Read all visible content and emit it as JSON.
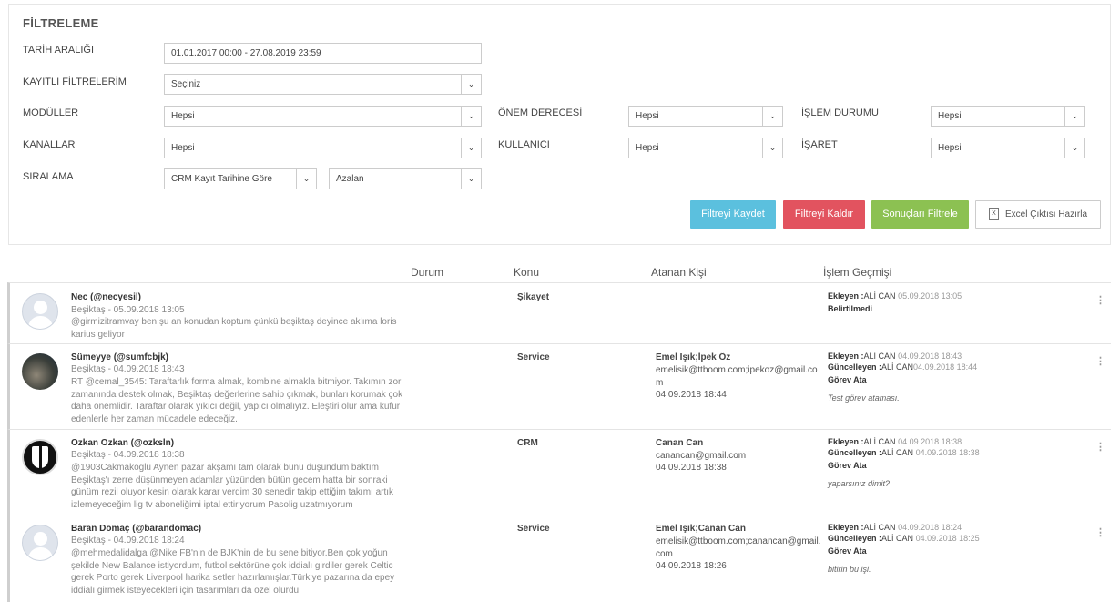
{
  "filters": {
    "title": "FİLTRELEME",
    "date_range": {
      "label": "TARİH ARALIĞI",
      "value": "01.01.2017 00:00 - 27.08.2019 23:59"
    },
    "saved_filters": {
      "label": "KAYITLI FİLTRELERİM",
      "value": "Seçiniz"
    },
    "modules": {
      "label": "MODÜLLER",
      "value": "Hepsi"
    },
    "channels": {
      "label": "KANALLAR",
      "value": "Hepsi"
    },
    "sorting": {
      "label": "SIRALAMA",
      "field": "CRM Kayıt Tarihine Göre",
      "order": "Azalan"
    },
    "priority": {
      "label": "ÖNEM DERECESİ",
      "value": "Hepsi"
    },
    "user": {
      "label": "KULLANICI",
      "value": "Hepsi"
    },
    "process_status": {
      "label": "İŞLEM DURUMU",
      "value": "Hepsi"
    },
    "mark": {
      "label": "İŞARET",
      "value": "Hepsi"
    },
    "buttons": {
      "save": "Filtreyi Kaydet",
      "remove": "Filtreyi Kaldır",
      "apply": "Sonuçları Filtrele",
      "excel": "Excel Çıktısı Hazırla"
    }
  },
  "table": {
    "headers": {
      "status": "Durum",
      "topic": "Konu",
      "assignee": "Atanan Kişi",
      "history": "İşlem Geçmişi"
    },
    "rows": [
      {
        "user": "Nec (@necyesil)",
        "meta": "Beşiktaş - 05.09.2018 13:05",
        "message": "@girmizitramvay ben şu an konudan koptum çünkü beşiktaş deyince aklıma loris karius geliyor",
        "topic": "Şikayet",
        "assignee_name": "",
        "assignee_email": "",
        "assignee_date": "",
        "history": [
          {
            "label": "Ekleyen :",
            "name": "ALİ CAN",
            "date": "05.09.2018 13:05"
          }
        ],
        "history_status": "Belirtilmedi",
        "history_note": ""
      },
      {
        "user": "Sümeyye (@sumfcbjk)",
        "meta": "Beşiktaş - 04.09.2018 18:43",
        "message": "RT @cemal_3545: Taraftarlık forma almak, kombine almakla bitmiyor. Takımın zor zamanında destek olmak, Beşiktaş değerlerine sahip çıkmak, bunları korumak çok daha önemlidir. Taraftar olarak yıkıcı değil, yapıcı olmalıyız. Eleştiri olur ama küfür edenlerle her zaman mücadele edeceğiz.",
        "topic": "Service",
        "assignee_name": "Emel Işık;İpek Öz",
        "assignee_email": "emelisik@ttboom.com;ipekoz@gmail.com",
        "assignee_date": "04.09.2018 18:44",
        "history": [
          {
            "label": "Ekleyen :",
            "name": "ALİ CAN",
            "date": "04.09.2018 18:43"
          },
          {
            "label": "Güncelleyen :",
            "name": "ALİ CAN",
            "date": "04.09.2018 18:44"
          }
        ],
        "history_status": "Görev Ata",
        "history_note": "Test görev ataması."
      },
      {
        "user": "Ozkan Ozkan (@ozksln)",
        "meta": "Beşiktaş - 04.09.2018 18:38",
        "message": "@1903Cakmakoglu Aynen pazar akşamı tam olarak bunu düşündüm baktım Beşiktaş'ı zerre düşünmeyen adamlar yüzünden bütün gecem hatta bir sonraki günüm rezil oluyor kesin olarak karar verdim 30 senedir takip ettiğim takımı artık izlemeyeceğim lig tv aboneliğimi iptal ettiriyorum Pasolig uzatmıyorum",
        "topic": "CRM",
        "assignee_name": "Canan Can",
        "assignee_email": "canancan@gmail.com",
        "assignee_date": "04.09.2018 18:38",
        "history": [
          {
            "label": "Ekleyen :",
            "name": "ALİ CAN",
            "date": "04.09.2018 18:38"
          },
          {
            "label": "Güncelleyen :",
            "name": "ALİ CAN",
            "date": "04.09.2018 18:38"
          }
        ],
        "history_status": "Görev Ata",
        "history_note": "yaparsınız dimit?"
      },
      {
        "user": "Baran Domaç (@barandomac)",
        "meta": "Beşiktaş - 04.09.2018 18:24",
        "message": "@mehmedalidalga @Nike FB'nin de BJK'nin de bu sene bitiyor.Ben çok yoğun şekilde New Balance istiyordum, futbol sektörüne çok iddialı girdiler gerek Celtic gerek Porto gerek Liverpool harika setler hazırlamışlar.Türkiye pazarına da epey iddialı girmek isteyecekleri için tasarımları da özel olurdu.",
        "topic": "Service",
        "assignee_name": "Emel Işık;Canan Can",
        "assignee_email": "emelisik@ttboom.com;canancan@gmail.com",
        "assignee_date": "04.09.2018 18:26",
        "history": [
          {
            "label": "Ekleyen :",
            "name": "ALİ CAN",
            "date": "04.09.2018 18:24"
          },
          {
            "label": "Güncelleyen :",
            "name": "ALİ CAN",
            "date": "04.09.2018 18:25"
          }
        ],
        "history_status": "Görev Ata",
        "history_note": "bitirin bu işi."
      }
    ]
  }
}
